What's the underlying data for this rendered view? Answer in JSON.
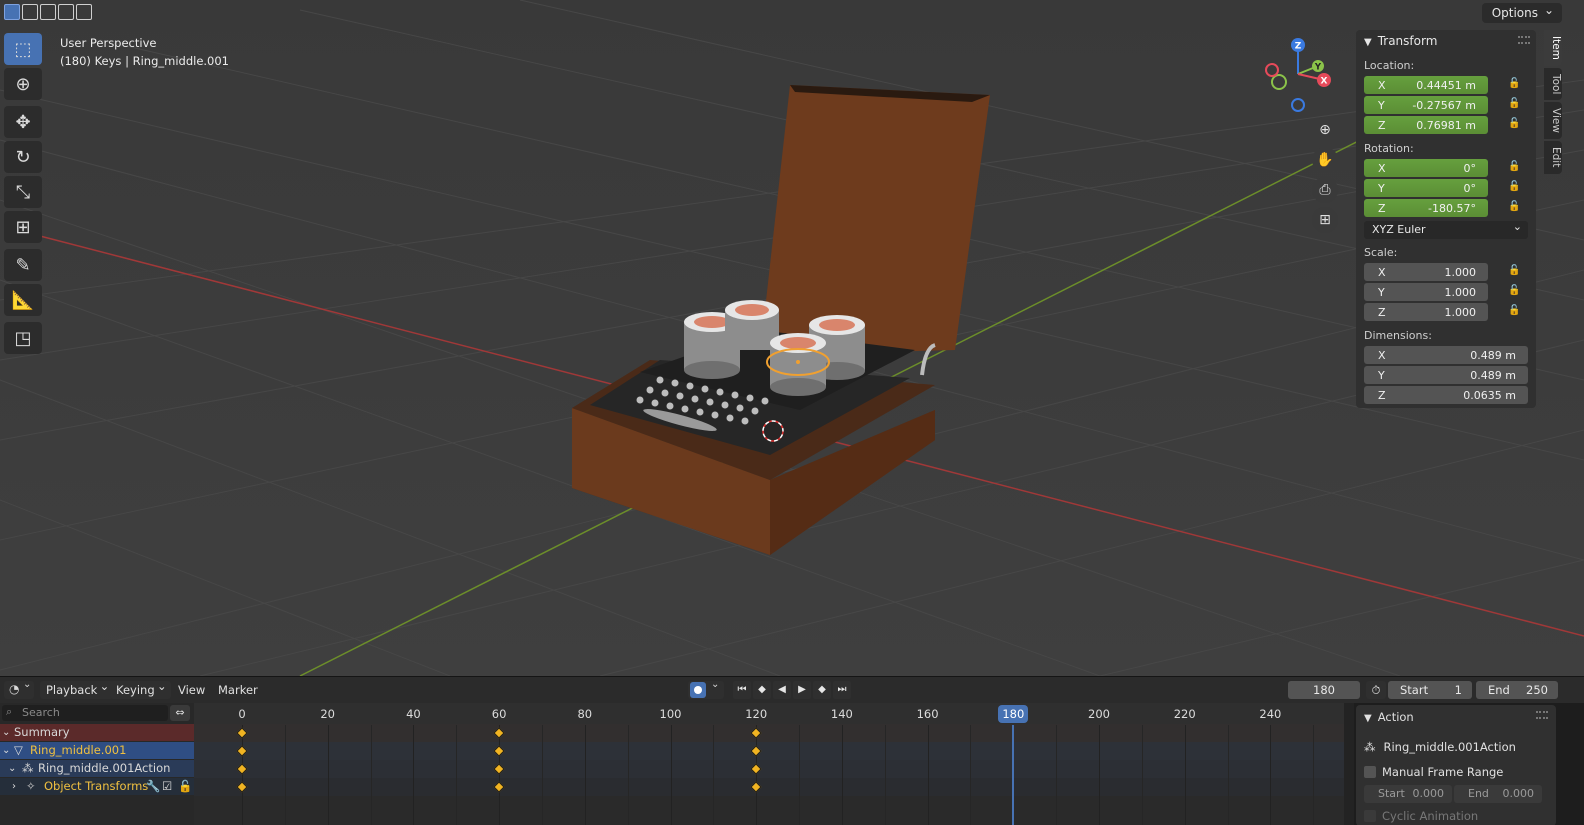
{
  "viewport": {
    "perspective": "User Perspective",
    "object_info": "(180) Keys | Ring_middle.001",
    "options_label": "Options",
    "gizmo_axes": [
      "Z",
      "Y",
      "X"
    ]
  },
  "toolbar": {
    "tools": [
      "select-box-icon",
      "cursor-icon",
      "move-icon",
      "rotate-icon",
      "scale-icon",
      "transform-icon",
      "annotate-icon",
      "measure-icon",
      "add-cube-icon"
    ]
  },
  "npanel": {
    "title": "Transform",
    "location_label": "Location:",
    "location": [
      {
        "axis": "X",
        "value": "0.44451 m"
      },
      {
        "axis": "Y",
        "value": "-0.27567 m"
      },
      {
        "axis": "Z",
        "value": "0.76981 m"
      }
    ],
    "rotation_label": "Rotation:",
    "rotation": [
      {
        "axis": "X",
        "value": "0°"
      },
      {
        "axis": "Y",
        "value": "0°"
      },
      {
        "axis": "Z",
        "value": "-180.57°"
      }
    ],
    "rotation_mode": "XYZ Euler",
    "scale_label": "Scale:",
    "scale": [
      {
        "axis": "X",
        "value": "1.000"
      },
      {
        "axis": "Y",
        "value": "1.000"
      },
      {
        "axis": "Z",
        "value": "1.000"
      }
    ],
    "dimensions_label": "Dimensions:",
    "dimensions": [
      {
        "axis": "X",
        "value": "0.489 m"
      },
      {
        "axis": "Y",
        "value": "0.489 m"
      },
      {
        "axis": "Z",
        "value": "0.0635 m"
      }
    ],
    "tabs": [
      "Item",
      "Tool",
      "View",
      "Edit"
    ]
  },
  "timeline": {
    "menus": {
      "playback": "Playback",
      "keying": "Keying",
      "view": "View",
      "marker": "Marker"
    },
    "current_frame": "180",
    "start_label": "Start",
    "start_value": "1",
    "end_label": "End",
    "end_value": "250",
    "search_placeholder": "Search",
    "channels": {
      "summary": "Summary",
      "object": "Ring_middle.001",
      "action": "Ring_middle.001Action",
      "group": "Object Transforms"
    },
    "ruler": [
      "0",
      "20",
      "40",
      "60",
      "80",
      "100",
      "120",
      "140",
      "160",
      "180",
      "200",
      "220",
      "240"
    ],
    "playhead_label": "180",
    "keyframes": [
      0,
      60,
      120
    ],
    "side": {
      "title": "Action",
      "action_name": "Ring_middle.001Action",
      "manual_range": "Manual Frame Range",
      "start_label": "Start",
      "start_value": "0.000",
      "end_label": "End",
      "end_value": "0.000",
      "cyclic": "Cyclic Animation"
    }
  }
}
